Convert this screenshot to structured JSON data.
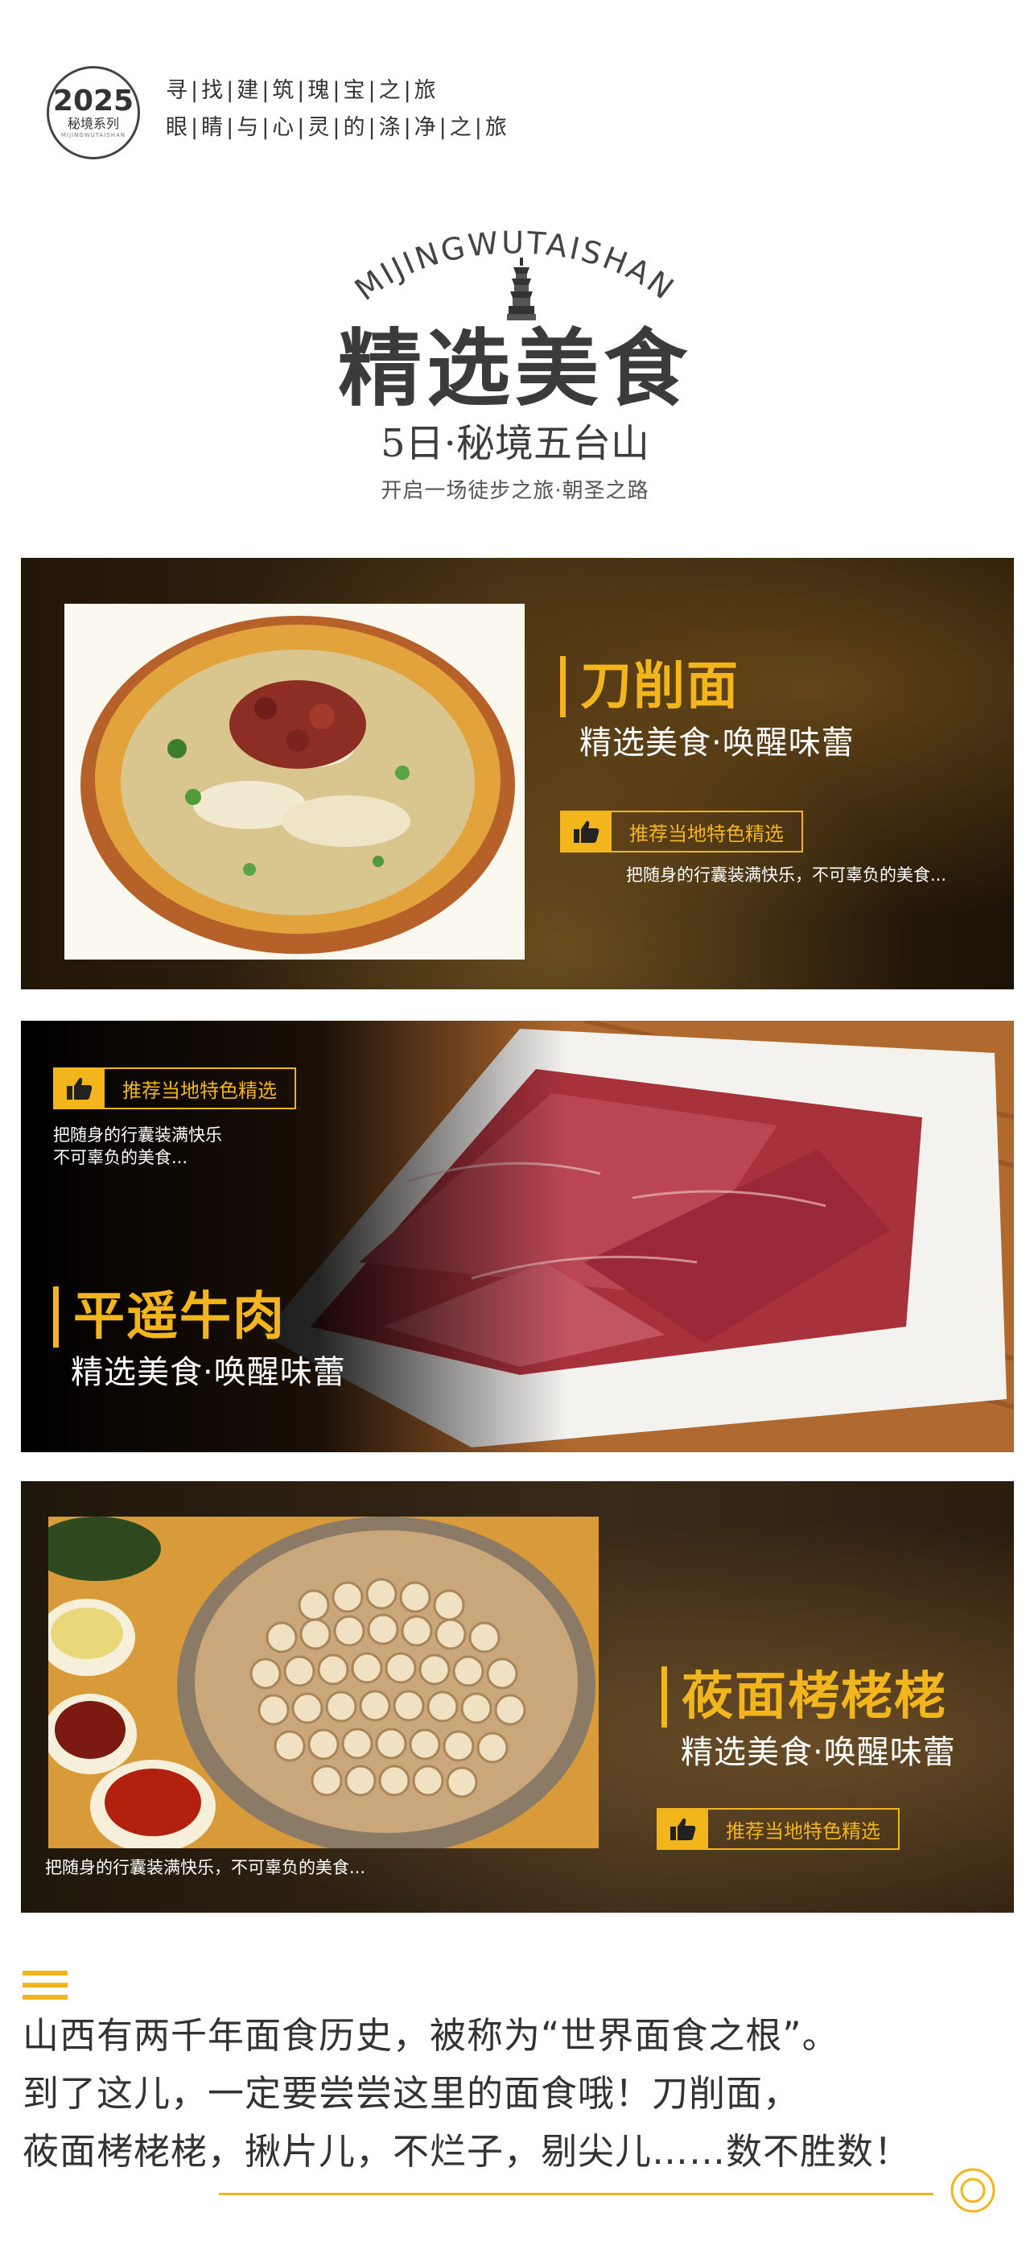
{
  "header": {
    "badge_year": "2025",
    "badge_series": "秘境系列",
    "badge_sub": "MIJINGWUTAISHAN",
    "slogan_line1": "寻|找|建|筑|瑰|宝|之|旅",
    "slogan_line2": "眼|睛|与|心|灵|的|涤|净|之|旅",
    "arc_text": "MIJINGWUTAISHAN",
    "title": "精选美食",
    "subtitle": "5日·秘境五台山",
    "tagline": "开启一场徒步之旅·朝圣之路"
  },
  "dishes": [
    {
      "name": "刀削面",
      "slogan": "精选美食·唤醒味蕾",
      "recommend": "推荐当地特色精选",
      "description": "把随身的行囊装满快乐，不可辜负的美食..."
    },
    {
      "name": "平遥牛肉",
      "slogan": "精选美食·唤醒味蕾",
      "recommend": "推荐当地特色精选",
      "description_line1": "把随身的行囊装满快乐",
      "description_line2": "不可辜负的美食..."
    },
    {
      "name": "莜面栲栳栳",
      "slogan": "精选美食·唤醒味蕾",
      "recommend": "推荐当地特色精选",
      "description": "把随身的行囊装满快乐，不可辜负的美食..."
    }
  ],
  "intro": {
    "line1": "山西有两千年面食历史，被称为“世界面食之根”。",
    "line2": "到了这儿，一定要尝尝这里的面食哦！刀削面，",
    "line3": "莜面栲栳栳，揪片儿，不烂子，剔尖儿……数不胜数！"
  },
  "icons": {
    "menu": "menu-lines-icon",
    "thumb": "thumbs-up-icon",
    "circle": "target-circle-icon",
    "pagoda": "pagoda-icon"
  },
  "colors": {
    "accent": "#f2b51c",
    "text_dark": "#333333"
  }
}
